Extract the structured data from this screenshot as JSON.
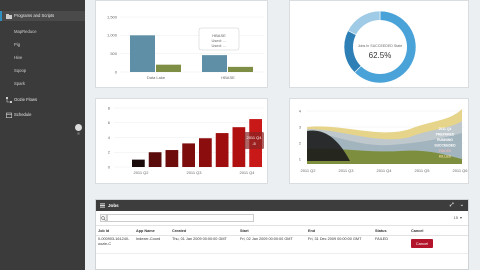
{
  "sidebar": {
    "items": [
      {
        "label": "Programs and Scripts",
        "icon": "folder-icon"
      },
      {
        "label": "MapReduce"
      },
      {
        "label": "Pig"
      },
      {
        "label": "Hive"
      },
      {
        "label": "Sqoop"
      },
      {
        "label": "Spark"
      },
      {
        "label": "Oozie Flows",
        "icon": "flow-icon"
      },
      {
        "label": "Schedule",
        "icon": "calendar-icon"
      }
    ]
  },
  "chart1": {
    "type": "bar",
    "categories": [
      "Data Lake",
      "HBASE"
    ],
    "series": [
      {
        "name": "",
        "color": "#5e8fa6",
        "values": [
          1000,
          460
        ]
      },
      {
        "name": "",
        "color": "#7f8e45",
        "values": [
          200,
          140
        ]
      }
    ],
    "y_ticks": [
      "1,500",
      "1,000",
      "500",
      "0"
    ],
    "tooltip": {
      "title": "HBASE",
      "lines": [
        "Used: ...",
        "Used: ..."
      ]
    }
  },
  "chart2": {
    "type": "pie",
    "center_label": "Jobs In SUCCEEDED State",
    "center_value": "62.5%",
    "slices": [
      {
        "value": 62.5,
        "color": "#4aa3d8"
      },
      {
        "value": 20,
        "color": "#2e7fb5"
      },
      {
        "value": 17.5,
        "color": "#9fcbe6"
      }
    ]
  },
  "chart3": {
    "type": "bar",
    "values": [
      1,
      2,
      2.3,
      3.2,
      3.9,
      4.6,
      5.4,
      6.5
    ],
    "ylim": [
      0,
      8
    ],
    "y_ticks": [
      "8",
      "6",
      "4",
      "2",
      "0"
    ],
    "x_ticks": [
      "2011 Q2",
      "2011 Q3",
      "2011 Q4"
    ],
    "colors": [
      "#1a0a0a",
      "#5a0b0b",
      "#6e0c0c",
      "#7d0c0c",
      "#8c0d0d",
      "#9e0e0e",
      "#b01010",
      "#c81818"
    ],
    "tooltip": {
      "title": "2011 Q4",
      "value": "-5"
    }
  },
  "chart4": {
    "type": "area",
    "x_ticks": [
      "2011 Q2",
      "2011 Q3",
      "2011 Q4",
      "2011 Q5",
      "2011 Q6"
    ],
    "y_ticks": [
      "4",
      "3",
      "2",
      "1"
    ],
    "legend": [
      "2011 Q4",
      "PREPARED",
      "RUNNING",
      "SUCCEEDED",
      "FAILED",
      "KILLED"
    ],
    "colors": [
      "#e6d48a",
      "#bfc8cc",
      "#8fa6b2",
      "#7d8f3e",
      "#1c1c1c"
    ]
  },
  "jobs": {
    "title": "Jobs",
    "page_size": "15",
    "columns": [
      "Job Id",
      "App Name",
      "Created",
      "Start",
      "End",
      "Status",
      "Cancel"
    ],
    "rows": [
      {
        "job_id": "0-000903-161240-oozie-C",
        "app_name": "Indexer-Coord",
        "created": "Thu, 01 Jan 2009 00:00:00 GMT",
        "start": "Fri, 02 Jan 2009 00:00:00 GMT",
        "end": "Fri, 31 Dec 2009 00:00:00 GMT",
        "status": "FAILED",
        "cancel_label": "Cancel"
      }
    ]
  }
}
